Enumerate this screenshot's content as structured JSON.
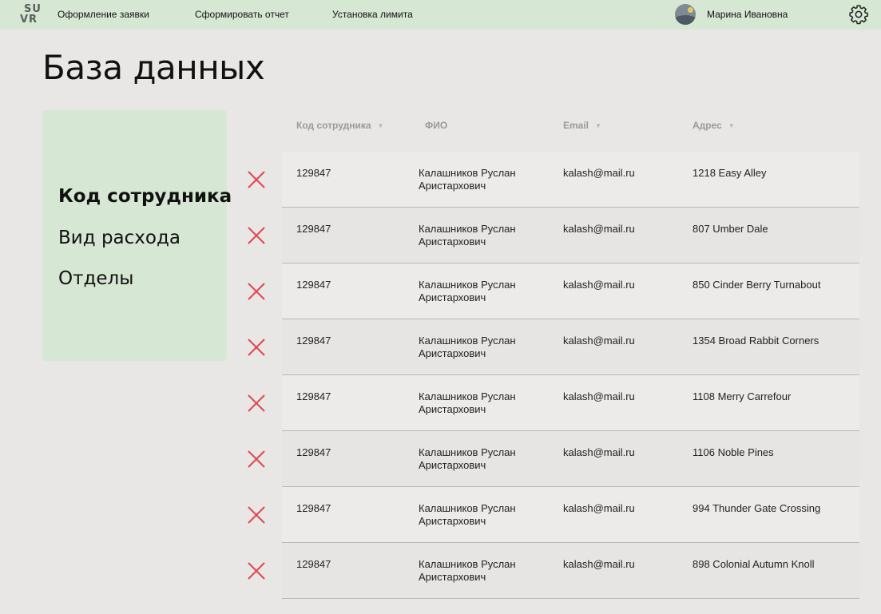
{
  "logo": {
    "line1": "SU",
    "line2": "VR"
  },
  "nav": [
    {
      "label": "Оформление заявки"
    },
    {
      "label": "Сформировать отчет"
    },
    {
      "label": "Установка лимита"
    }
  ],
  "user": {
    "name": "Марина Ивановна",
    "avatar_icon": "avatar-image-icon"
  },
  "settings_icon": "gear-icon",
  "page": {
    "title": "База данных"
  },
  "sidebar": {
    "items": [
      {
        "label": "Код сотрудника",
        "active": true
      },
      {
        "label": "Вид расхода",
        "active": false
      },
      {
        "label": "Отделы",
        "active": false
      }
    ]
  },
  "table": {
    "columns": [
      {
        "label": "Код сотрудника",
        "sortable": true
      },
      {
        "label": "ФИО",
        "sortable": false
      },
      {
        "label": "Email",
        "sortable": true
      },
      {
        "label": "Адрес",
        "sortable": true
      }
    ],
    "delete_icon": "close-icon",
    "delete_color": "#e0474c",
    "rows": [
      {
        "id": "129847",
        "fio": "Калашников Руслан Аристархович",
        "email": "kalash@mail.ru",
        "address": "1218 Easy Alley"
      },
      {
        "id": "129847",
        "fio": "Калашников Руслан Аристархович",
        "email": "kalash@mail.ru",
        "address": "807 Umber Dale"
      },
      {
        "id": "129847",
        "fio": "Калашников Руслан Аристархович",
        "email": "kalash@mail.ru",
        "address": "850 Cinder Berry Turnabout"
      },
      {
        "id": "129847",
        "fio": "Калашников Руслан Аристархович",
        "email": "kalash@mail.ru",
        "address": "1354 Broad Rabbit Corners"
      },
      {
        "id": "129847",
        "fio": "Калашников Руслан Аристархович",
        "email": "kalash@mail.ru",
        "address": "1108 Merry Carrefour"
      },
      {
        "id": "129847",
        "fio": "Калашников Руслан Аристархович",
        "email": "kalash@mail.ru",
        "address": "1106 Noble Pines"
      },
      {
        "id": "129847",
        "fio": "Калашников Руслан Аристархович",
        "email": "kalash@mail.ru",
        "address": "994 Thunder Gate Crossing"
      },
      {
        "id": "129847",
        "fio": "Калашников Руслан Аристархович",
        "email": "kalash@mail.ru",
        "address": "898 Colonial Autumn Knoll"
      }
    ]
  },
  "colors": {
    "topbar": "#d6e8d3",
    "sidebar": "#d6e8d3",
    "background": "#e8e7e5"
  }
}
